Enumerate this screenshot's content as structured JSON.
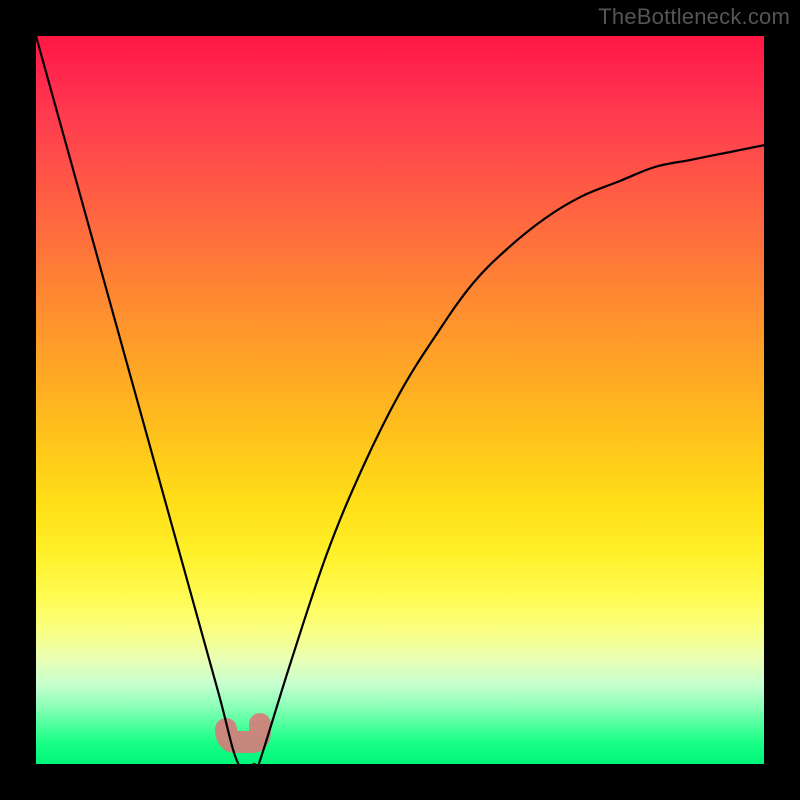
{
  "watermark": "TheBottleneck.com",
  "colors": {
    "frame": "#000000",
    "curve": "#000000",
    "blob": "#d87a7a",
    "gradient_top": "#ff1744",
    "gradient_bottom": "#00f57a"
  },
  "chart_data": {
    "type": "line",
    "title": "",
    "xlabel": "",
    "ylabel": "",
    "x": [
      0.0,
      0.05,
      0.1,
      0.15,
      0.2,
      0.25,
      0.278,
      0.3,
      0.306,
      0.35,
      0.4,
      0.45,
      0.5,
      0.55,
      0.6,
      0.65,
      0.7,
      0.75,
      0.8,
      0.85,
      0.9,
      0.95,
      1.0
    ],
    "values": [
      1.0,
      0.82,
      0.64,
      0.46,
      0.28,
      0.1,
      0.0,
      0.0,
      0.0,
      0.14,
      0.29,
      0.41,
      0.51,
      0.59,
      0.66,
      0.71,
      0.75,
      0.78,
      0.8,
      0.82,
      0.83,
      0.84,
      0.85
    ],
    "xlim": [
      0,
      1
    ],
    "ylim": [
      0,
      1
    ],
    "annotations": {
      "minimum_band_x": [
        0.255,
        0.31
      ],
      "minimum_y": 0.0
    },
    "notes": "V-shaped bottleneck curve. y axis represents bottleneck severity (0 = no bottleneck / green, 1 = severe / red). Background gradient maps y value to color. Rounded salmon marker highlights the flat minimum region around x≈0.28."
  }
}
